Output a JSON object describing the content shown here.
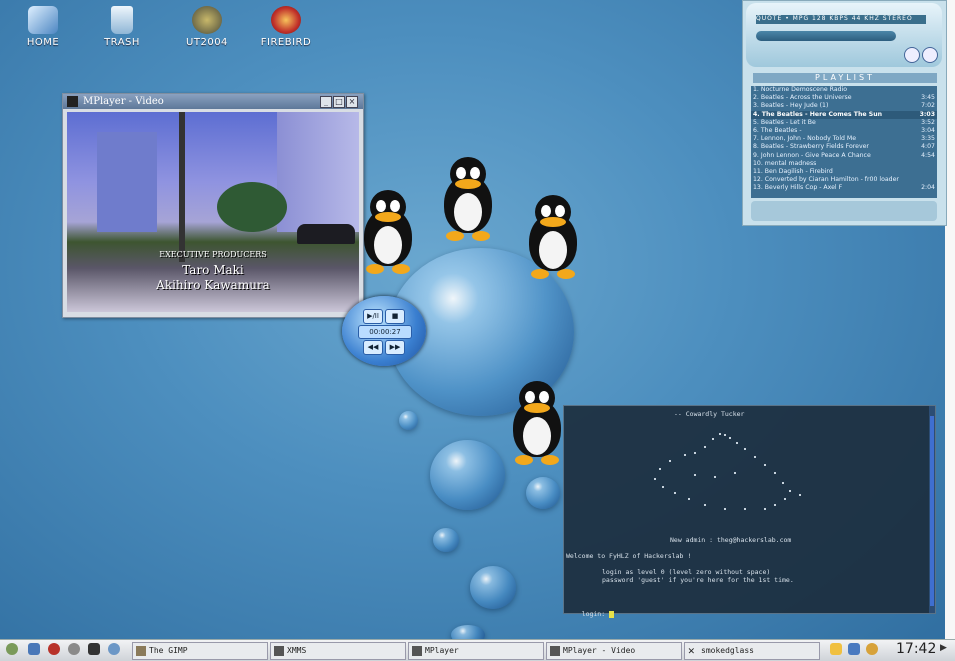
{
  "desktop": {
    "icons": [
      {
        "label": "HOME",
        "color": "#5b93c9"
      },
      {
        "label": "TRASH",
        "color": "#8fb6d6"
      },
      {
        "label": "UT2004",
        "color": "#6b6a5a"
      },
      {
        "label": "FIREBIRD",
        "color": "#c0302a"
      }
    ]
  },
  "mplayer": {
    "title": "MPlayer - Video",
    "credits": {
      "heading": "EXECUTIVE PRODUCERS",
      "line1": "Taro Maki",
      "line2": "Akihiro Kawamura"
    },
    "controls": {
      "play_pause": "▶/II",
      "stop": "■",
      "time": "00:00:27",
      "rewind": "◀◀",
      "forward": "▶▶"
    }
  },
  "xmms": {
    "info_text": "QUOTE • MPG 128 KBPS 44 KHZ STEREO",
    "playlist_title": "PLAYLIST",
    "playlist": [
      {
        "title": "1. Nocturne Demoscene Radio",
        "duration": ""
      },
      {
        "title": "2. Beatles - Across the Universe",
        "duration": "3:45"
      },
      {
        "title": "3. Beatles - Hey Jude (1)",
        "duration": "7:02"
      },
      {
        "title": "4. The Beatles - Here Comes The Sun",
        "duration": "3:03",
        "current": true
      },
      {
        "title": "5. Beatles - Let it Be",
        "duration": "3:52"
      },
      {
        "title": "6. The Beatles -",
        "duration": "3:04"
      },
      {
        "title": "7. Lennon, John - Nobody Told Me",
        "duration": "3:35"
      },
      {
        "title": "8. Beatles - Strawberry Fields Forever",
        "duration": "4:07"
      },
      {
        "title": "9. John Lennon - Give Peace A Chance",
        "duration": "4:54"
      },
      {
        "title": "10. mental madness",
        "duration": ""
      },
      {
        "title": "11. Ben Dagilish - Firebird",
        "duration": ""
      },
      {
        "title": "12. Converted by Ciaran Hamilton - fr00 loader",
        "duration": ""
      },
      {
        "title": "13. Beverly Hills Cop - Axel F",
        "duration": "2:04"
      }
    ]
  },
  "terminal": {
    "header": "-- Cowardly Tucker",
    "new_admin": "New admin : theg@hackerslab.com",
    "welcome": "Welcome to FyHLZ of Hackerslab !",
    "login_level": "login as level 0 (level zero without space)",
    "password_hint": "password 'guest' if you're here for the 1st time.",
    "prompt": "login: "
  },
  "taskbar": {
    "tasks": [
      {
        "label": "The GIMP",
        "icon": "gimp-icon"
      },
      {
        "label": "XMMS",
        "icon": "xmms-icon"
      },
      {
        "label": "MPlayer",
        "icon": "mplayer-icon"
      },
      {
        "label": "MPlayer - Video",
        "icon": "mplayer-icon"
      },
      {
        "label": "smokedglass",
        "icon": "x-terminal-icon"
      }
    ],
    "clock": "17:42"
  },
  "colors": {
    "desktop_accent": "#4d8fbf",
    "terminal_bg": "#1c2e3e",
    "playlist_bg": "#3d6f92"
  }
}
